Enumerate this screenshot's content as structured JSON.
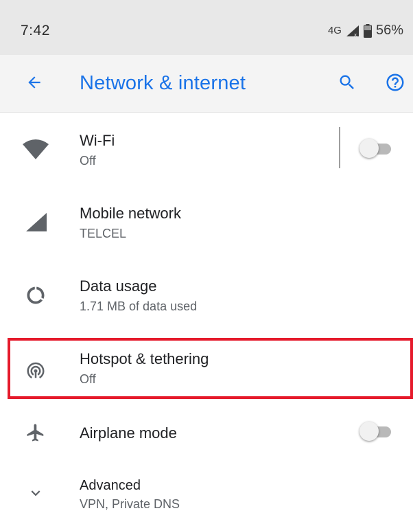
{
  "status_bar": {
    "time": "7:42",
    "network": "4G",
    "battery": "56%"
  },
  "app_bar": {
    "title": "Network & internet",
    "back_icon": "arrow-back-icon",
    "search_icon": "search-icon",
    "help_icon": "help-icon"
  },
  "items": [
    {
      "title": "Wi-Fi",
      "summary": "Off",
      "icon": "wifi-icon",
      "toggle": false
    },
    {
      "title": "Mobile network",
      "summary": "TELCEL",
      "icon": "cellular-signal-icon"
    },
    {
      "title": "Data usage",
      "summary": "1.71 MB of data used",
      "icon": "data-usage-icon"
    },
    {
      "title": "Hotspot & tethering",
      "summary": "Off",
      "icon": "hotspot-icon"
    },
    {
      "title": "Airplane mode",
      "icon": "airplane-icon",
      "toggle": false
    },
    {
      "title": "Advanced",
      "summary": "VPN, Private DNS",
      "icon": "chevron-down-icon"
    }
  ],
  "colors": {
    "accent": "#1a73e8",
    "highlight": "#e51a2b",
    "icon": "#5f6368"
  }
}
